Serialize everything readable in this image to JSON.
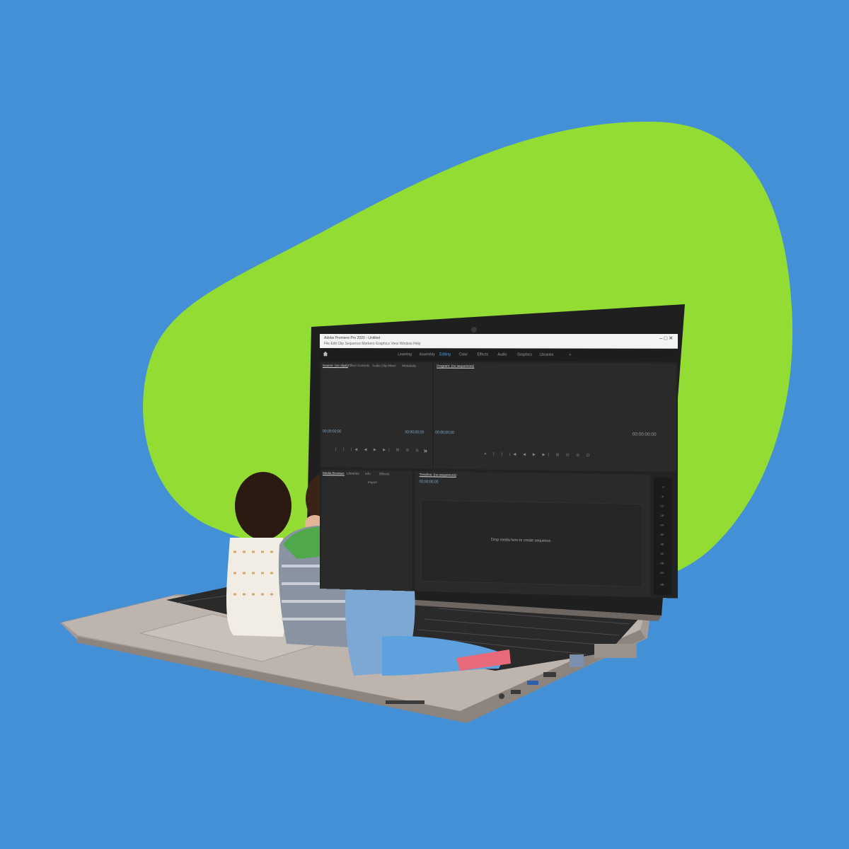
{
  "colors": {
    "background": "#4490d6",
    "blob": "#92dc34",
    "laptop_body": "#bcb2aa",
    "screen_bg": "#232323"
  },
  "app": {
    "title_line1": "Adobe Premiere Pro 2020 - Untitled",
    "title_line2": "File  Edit  Clip  Sequence  Markers  Graphics  View  Window  Help",
    "window_controls": "–  □  ✕",
    "workspaces": [
      "Learning",
      "Assembly",
      "Editing",
      "Color",
      "Effects",
      "Audio",
      "Graphics",
      "Libraries"
    ],
    "workspace_active": "Editing",
    "more": "»",
    "source_tabs": [
      "Source: (no clips)",
      "Effect Controls",
      "Audio Clip Mixer",
      "Metadata"
    ],
    "program_tab": "Program: (no sequences)",
    "source_tc_left": "00;00;00;00",
    "source_tc_right": "00;00;00;00",
    "program_tc_left": "00;00;00;00",
    "program_tc_right": "00;00;00;00",
    "source_controls": "{ } |◀ ◀ ▶ ▶| ⊞ ⊟ ◎",
    "program_controls": "▾ { } |◀ ◀ ▶ ▶| ⊞ ⊟ ◎ ⊡",
    "project_tabs": [
      "Media Browser",
      "Libraries",
      "Info",
      "Effects"
    ],
    "import_label": "Import",
    "timeline_tab": "Timeline: (no sequences)",
    "timeline_tc": "00;00;00;00",
    "timeline_message": "Drop media here to create sequence.",
    "meter_labels": [
      "0",
      "-6",
      "-12",
      "-18",
      "-24",
      "-30",
      "-36",
      "-42",
      "-48",
      "-54",
      "dB"
    ]
  }
}
